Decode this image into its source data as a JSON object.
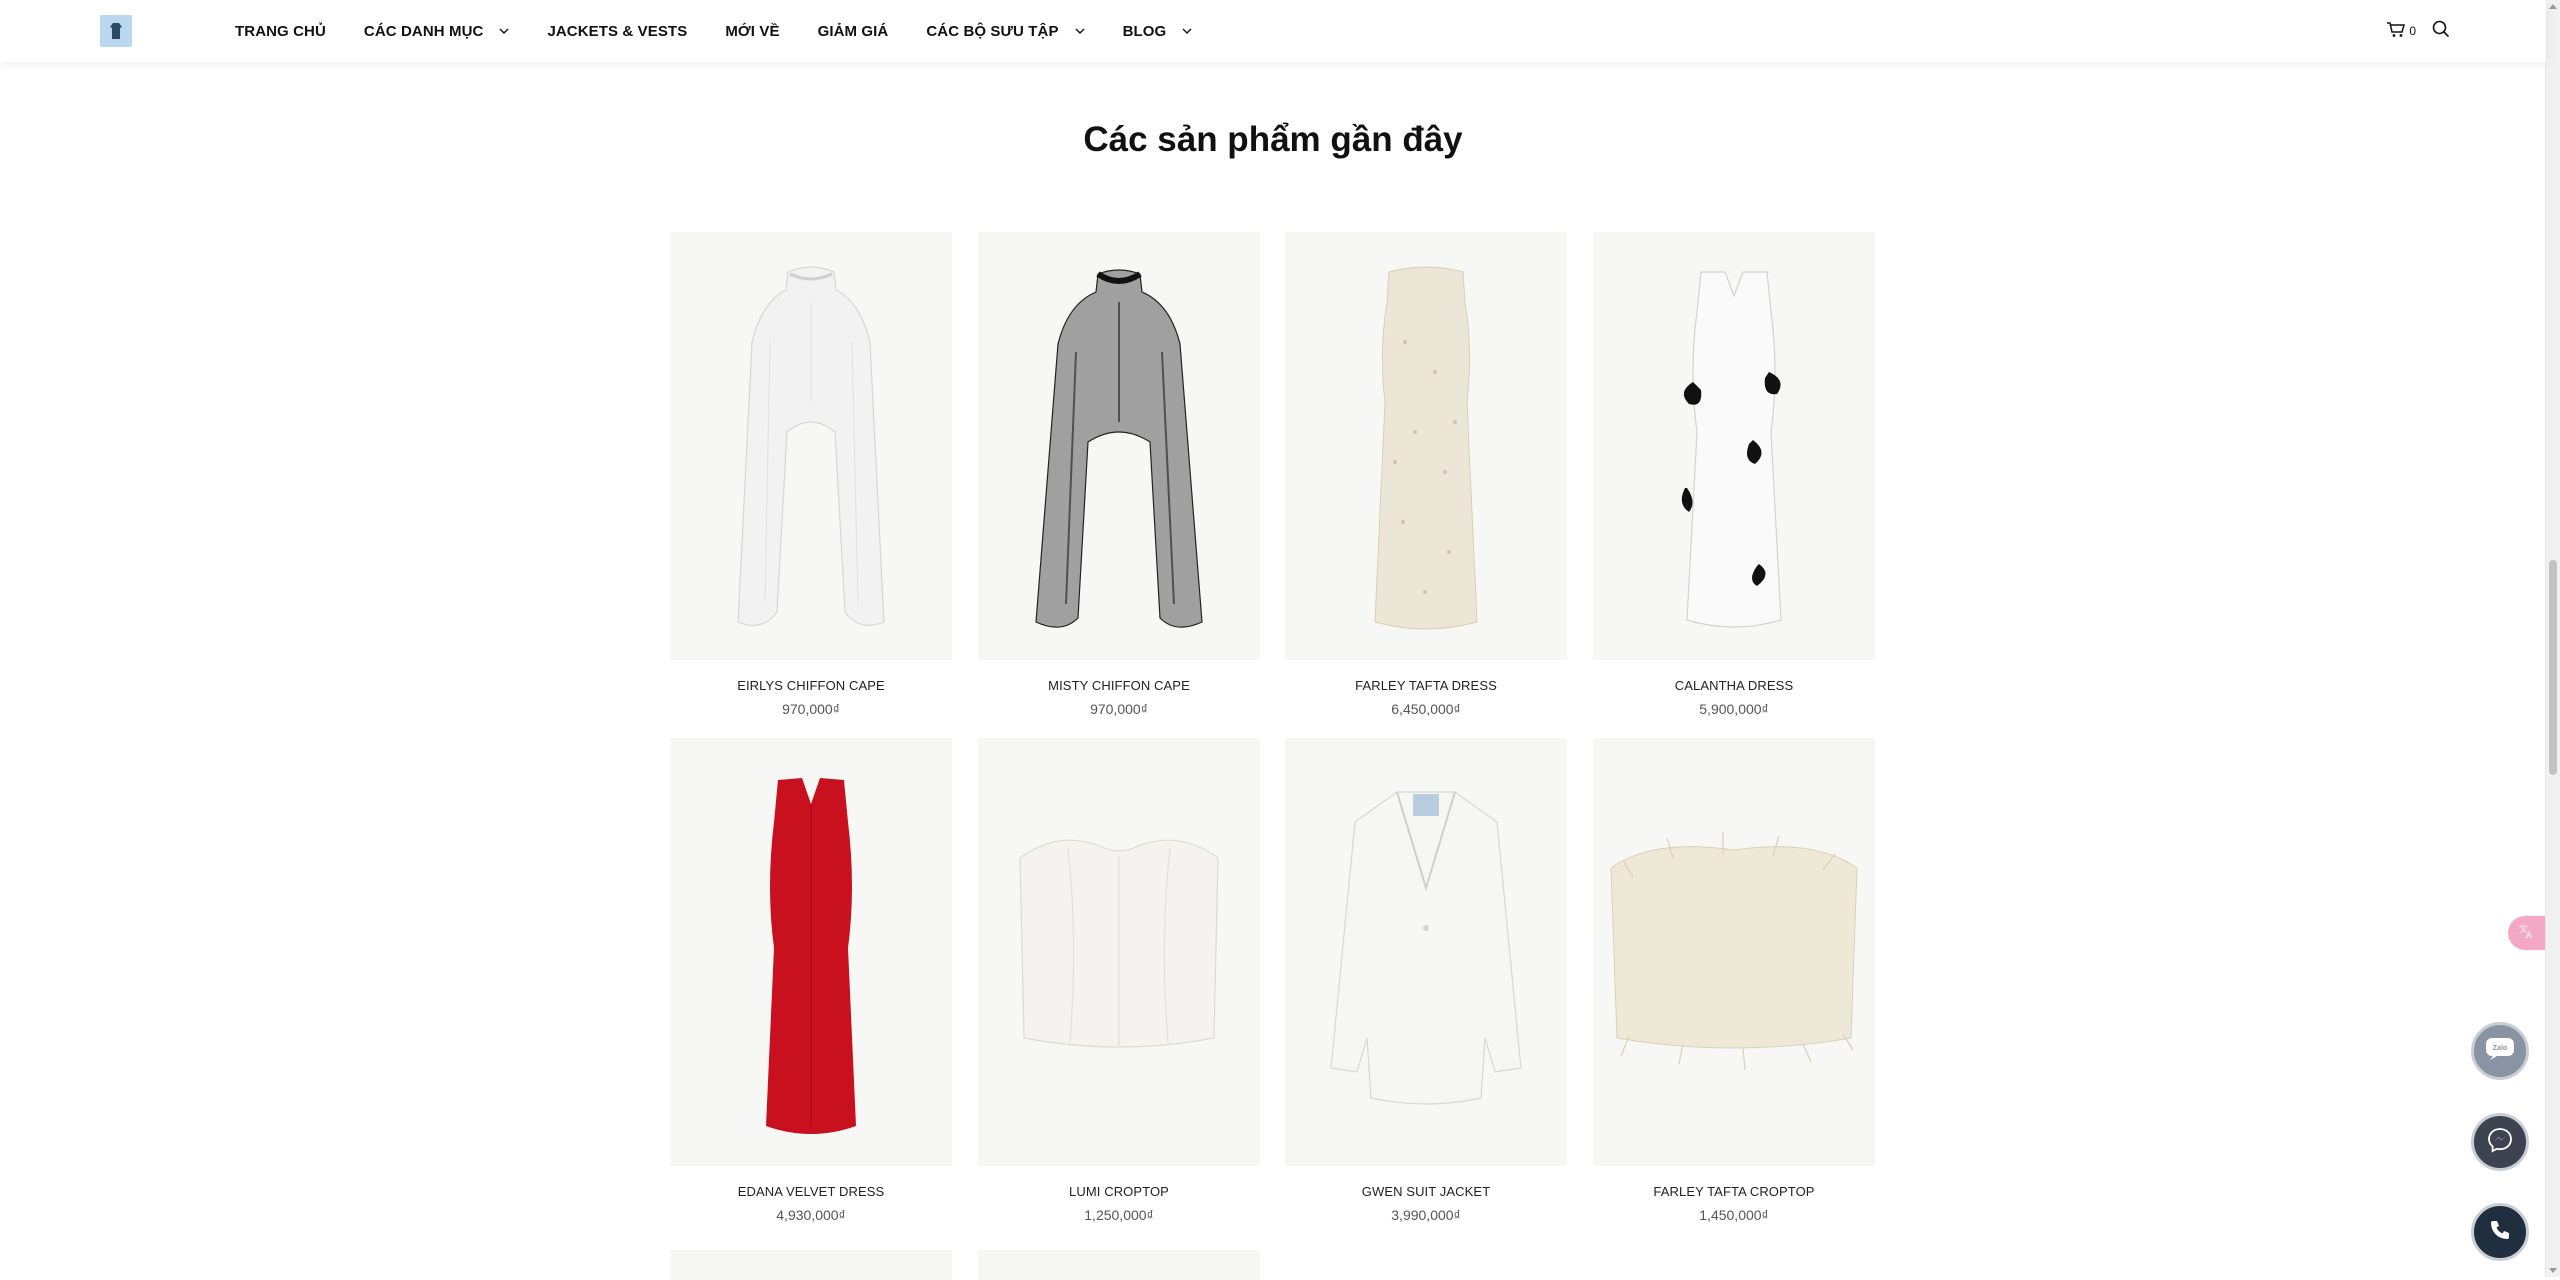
{
  "header": {
    "logo_icon": "logo-icon",
    "nav": [
      {
        "label": "TRANG CHỦ",
        "has_dropdown": false
      },
      {
        "label": "CÁC DANH MỤC",
        "has_dropdown": true
      },
      {
        "label": "JACKETS & VESTS",
        "has_dropdown": false
      },
      {
        "label": "MỚI VỀ",
        "has_dropdown": false
      },
      {
        "label": "GIẢM GIÁ",
        "has_dropdown": false
      },
      {
        "label": "CÁC BỘ SƯU TẬP",
        "has_dropdown": true
      },
      {
        "label": "BLOG",
        "has_dropdown": true
      }
    ],
    "cart_count": "0"
  },
  "section": {
    "title": "Các sản phẩm gần đây"
  },
  "products": [
    {
      "name": "EIRLYS CHIFFON CAPE",
      "price": "970,000₫",
      "image": "white-chiffon-cape"
    },
    {
      "name": "MISTY CHIFFON CAPE",
      "price": "970,000₫",
      "image": "black-chiffon-cape"
    },
    {
      "name": "FARLEY TAFTA DRESS",
      "price": "6,450,000₫",
      "image": "cream-feather-dress"
    },
    {
      "name": "CALANTHA DRESS",
      "price": "5,900,000₫",
      "image": "white-dress-black-flowers"
    },
    {
      "name": "EDANA VELVET DRESS",
      "price": "4,930,000₫",
      "image": "red-velvet-dress"
    },
    {
      "name": "LUMI CROPTOP",
      "price": "1,250,000₫",
      "image": "white-bustier-croptop"
    },
    {
      "name": "GWEN SUIT JACKET",
      "price": "3,990,000₫",
      "image": "white-suit-jacket"
    },
    {
      "name": "FARLEY TAFTA CROPTOP",
      "price": "1,450,000₫",
      "image": "cream-feather-croptop"
    }
  ],
  "widgets": {
    "zalo_label": "Zalo",
    "colors": {
      "zalo": "#8a93a3",
      "messenger": "#3d4350",
      "phone": "#1f2f40",
      "translate": "#f5a8c4"
    }
  }
}
